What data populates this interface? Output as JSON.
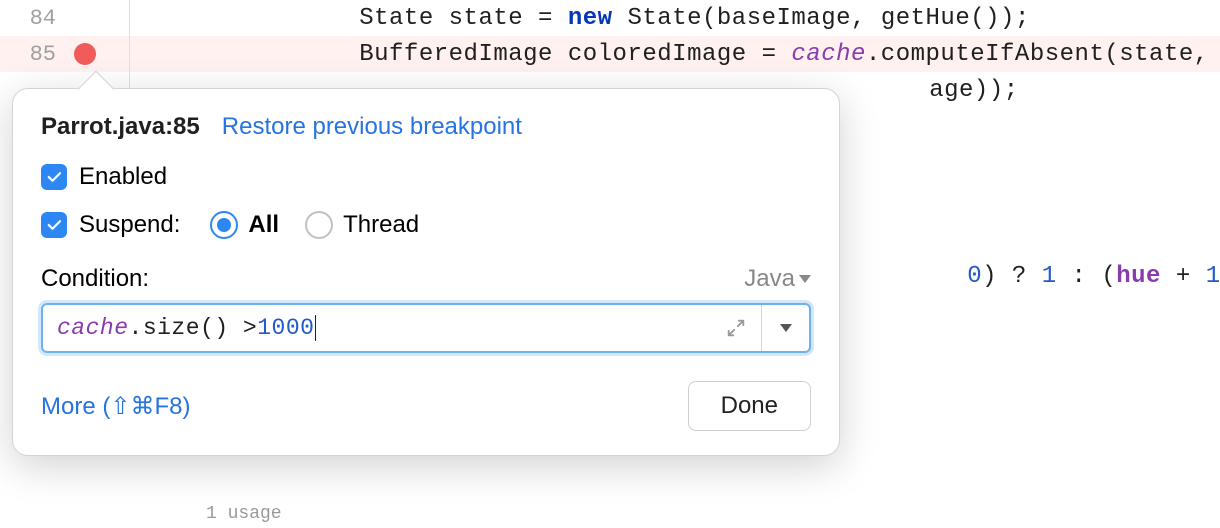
{
  "editor": {
    "lines": [
      {
        "num": "84",
        "breakpoint": false,
        "highlight": false
      },
      {
        "num": "85",
        "breakpoint": true,
        "highlight": true
      }
    ],
    "code84": {
      "pre": "State state = ",
      "kw": "new",
      "post": " State(baseImage, getHue());"
    },
    "code85": {
      "a": "BufferedImage coloredImage = ",
      "b": "cache",
      "c": ".computeIfAbsent(state, (s)"
    },
    "code86_tail": "age));",
    "ternary": {
      "a": "0",
      "b": ") ? ",
      "c": "1",
      "d": " : (",
      "e": "hue",
      "f": " + ",
      "g": "1",
      "h": "); ",
      "brace": "}"
    },
    "usage": "1 usage"
  },
  "popover": {
    "title": "Parrot.java:85",
    "restore": "Restore previous breakpoint",
    "enabled_label": "Enabled",
    "suspend_label": "Suspend:",
    "radio_all": "All",
    "radio_thread": "Thread",
    "condition_label": "Condition:",
    "language": "Java",
    "condition_value": {
      "a": "cache",
      "b": ".size() > ",
      "c": "1000"
    },
    "more": "More (⇧⌘F8)",
    "done": "Done"
  }
}
